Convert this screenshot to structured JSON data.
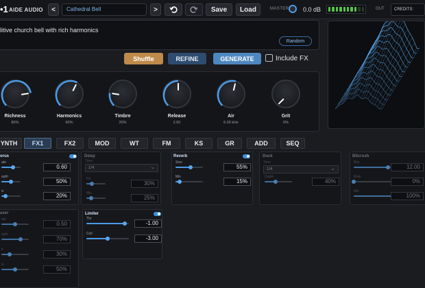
{
  "app": {
    "logo": "•1",
    "brand": "AIDE AUDIO"
  },
  "toolbar": {
    "prev": "<",
    "next": ">",
    "preset_name": "Cathedral Bell",
    "undo_icon": "undo-icon",
    "redo_icon": "redo-icon",
    "save": "Save",
    "load": "Load",
    "master_label": "MASTER",
    "master_value": "0.0 dB",
    "out_label": "OUT",
    "credits_label": "CREDITS:"
  },
  "prompt": {
    "text": "litive church bell with rich harmonics",
    "random": "Random",
    "shuffle": "Shuffle",
    "refine": "REFINE",
    "generate": "GENERATE",
    "include_fx": "Include FX",
    "include_fx_checked": false
  },
  "macros": [
    {
      "name": "Richness",
      "value": "80%",
      "level": 0.8
    },
    {
      "name": "Harmonics",
      "value": "60%",
      "level": 0.6
    },
    {
      "name": "Timbre",
      "value": "20%",
      "level": 0.2
    },
    {
      "name": "Release",
      "value": "2.50",
      "level": 0.5
    },
    {
      "name": "Air",
      "value": "6.00 kHz",
      "level": 0.55
    },
    {
      "name": "Grit",
      "value": "0%",
      "level": 0.0
    }
  ],
  "tabs": [
    "YNTH",
    "FX1",
    "FX2",
    "MOD",
    "WT",
    "FM",
    "KS",
    "GR",
    "ADD",
    "SEQ"
  ],
  "active_tab": "FX1",
  "modules": {
    "chorus": {
      "title": "orus",
      "params": [
        {
          "label": "ate",
          "value": "0.60",
          "level": 0.6
        },
        {
          "label": "epth",
          "value": "50%",
          "level": 0.5
        },
        {
          "label": "ix",
          "value": "20%",
          "level": 0.2
        }
      ]
    },
    "delay": {
      "title": "Delay",
      "time_label": "Time",
      "time_value": "1/4",
      "params": [
        {
          "label": "Fd",
          "value": "30%",
          "level": 0.3
        },
        {
          "label": "Mix",
          "value": "25%",
          "level": 0.25
        }
      ]
    },
    "reverb": {
      "title": "Reverb",
      "params": [
        {
          "label": "Size",
          "value": "55%",
          "level": 0.55
        },
        {
          "label": "Mix",
          "value": "15%",
          "level": 0.15
        }
      ]
    },
    "duck": {
      "title": "Duck",
      "time_label": "Time",
      "time_value": "1/4",
      "params": [
        {
          "label": "Depth",
          "value": "40%",
          "level": 0.4
        }
      ]
    },
    "bitcrush": {
      "title": "Bitcrush",
      "params": [
        {
          "label": "Bits",
          "value": "12.00",
          "level": 0.75
        },
        {
          "label": "Rate",
          "value": "0%",
          "level": 0.0
        },
        {
          "label": "Mix",
          "value": "100%",
          "level": 1.0
        }
      ]
    },
    "phaser": {
      "title": "aser",
      "params": [
        {
          "label": "ate",
          "value": "0.50",
          "level": 0.5
        },
        {
          "label": "epth",
          "value": "70%",
          "level": 0.7
        },
        {
          "label": "b",
          "value": "30%",
          "level": 0.3
        },
        {
          "label": "ix",
          "value": "50%",
          "level": 0.5
        }
      ]
    },
    "limiter": {
      "title": "Limiter",
      "params": [
        {
          "label": "Thr",
          "value": "-1.00",
          "level": 0.9
        },
        {
          "label": "Ceil",
          "value": "-3.00",
          "level": 0.5
        }
      ]
    }
  },
  "colors": {
    "accent": "#4c9be6",
    "shuffle": "#bf8a4b",
    "generate": "#4d88c0",
    "meter": "#57c24a",
    "wavetable": "#5aa8ef"
  }
}
